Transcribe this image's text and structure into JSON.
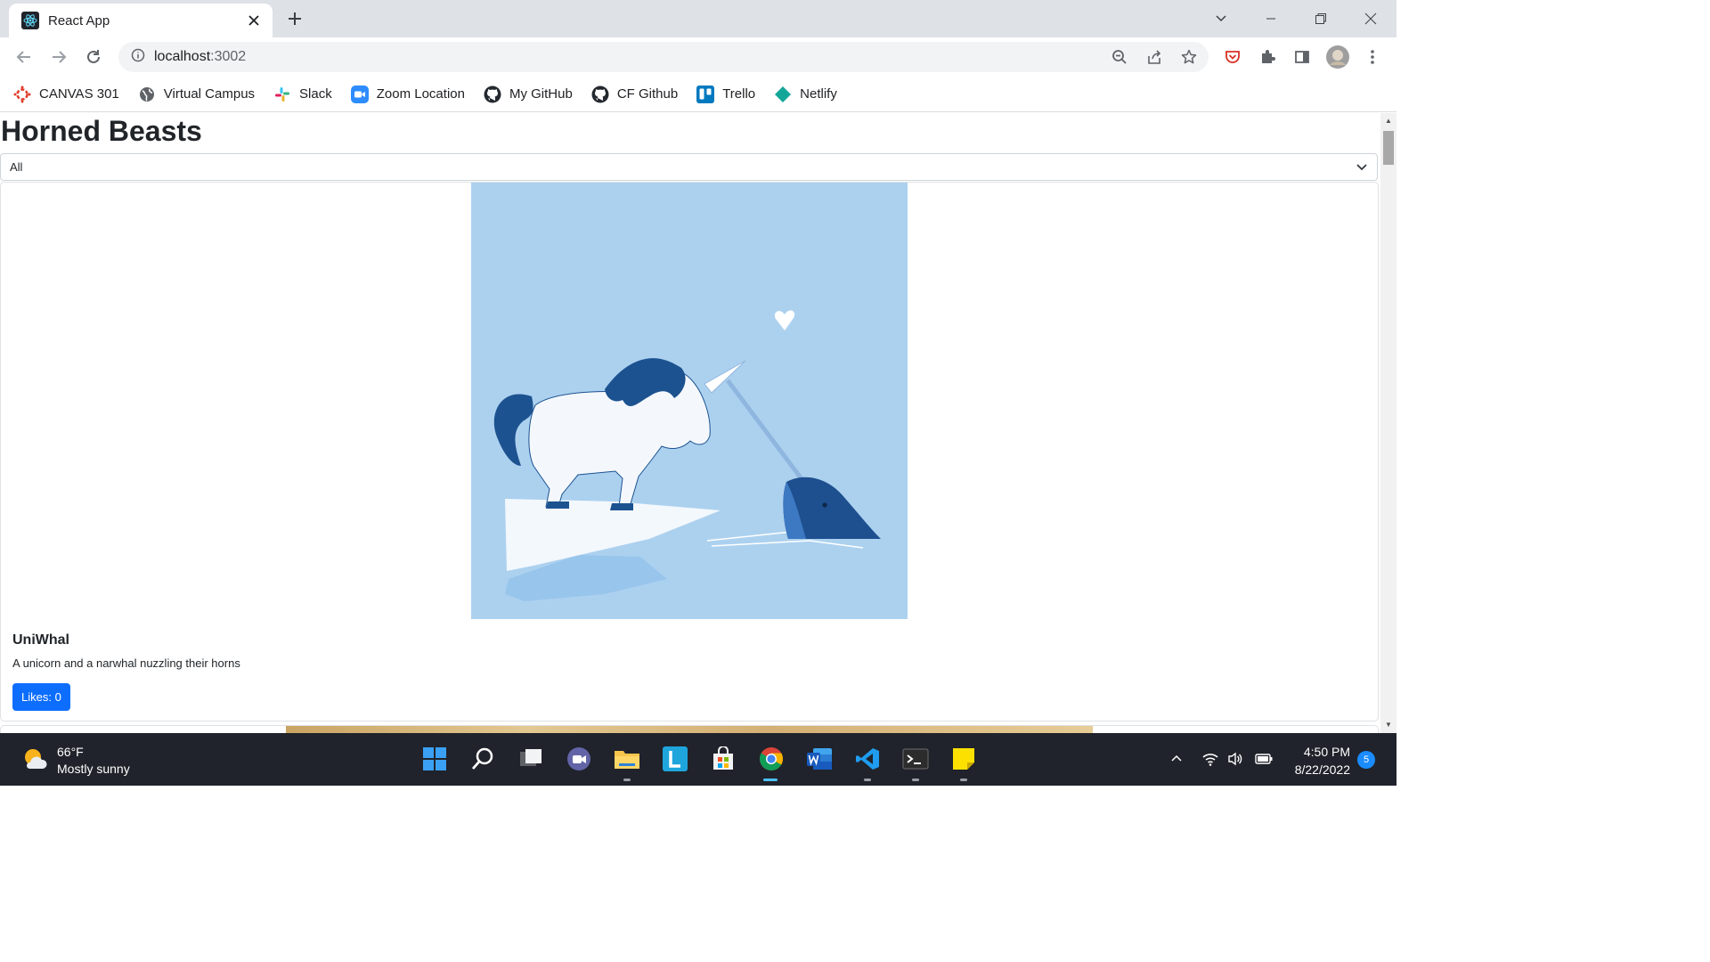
{
  "browser": {
    "tab_title": "React App",
    "url_host": "localhost",
    "url_port": ":3002"
  },
  "bookmarks": [
    {
      "label": "CANVAS 301",
      "icon": "canvas-icon"
    },
    {
      "label": "Virtual Campus",
      "icon": "globe-icon"
    },
    {
      "label": "Slack",
      "icon": "slack-icon"
    },
    {
      "label": "Zoom Location",
      "icon": "zoom-icon"
    },
    {
      "label": "My GitHub",
      "icon": "github-icon"
    },
    {
      "label": "CF Github",
      "icon": "github-icon"
    },
    {
      "label": "Trello",
      "icon": "trello-icon"
    },
    {
      "label": "Netlify",
      "icon": "netlify-icon"
    }
  ],
  "page": {
    "title": "Horned Beasts",
    "filter_value": "All",
    "card": {
      "title": "UniWhal",
      "description": "A unicorn and a narwhal nuzzling their horns",
      "likes_label": "Likes: 0"
    }
  },
  "taskbar": {
    "weather_temp": "66°F",
    "weather_desc": "Mostly sunny",
    "time": "4:50 PM",
    "date": "8/22/2022",
    "notification_count": "5"
  },
  "colors": {
    "primary_button": "#0d6efd",
    "image_background": "#acd1ef",
    "taskbar": "#20232b"
  }
}
